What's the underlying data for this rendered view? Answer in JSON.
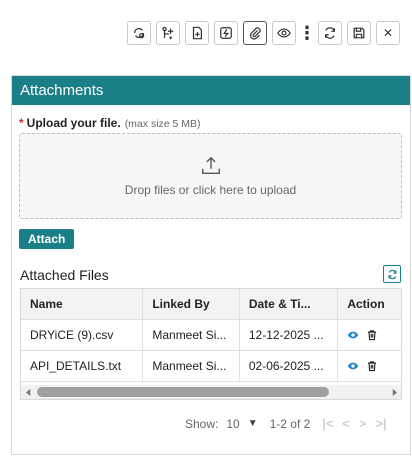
{
  "toolbar": {
    "buttons": [
      {
        "icon": "settings-sync-icon"
      },
      {
        "icon": "add-flow-icon"
      },
      {
        "icon": "add-document-icon"
      },
      {
        "icon": "activity-icon"
      },
      {
        "icon": "paperclip-icon"
      },
      {
        "icon": "eye-icon"
      },
      {
        "icon": "more-vertical-icon"
      },
      {
        "icon": "refresh-icon"
      },
      {
        "icon": "save-icon"
      },
      {
        "icon": "close-icon"
      }
    ],
    "more_glyph": "⋮",
    "close_glyph": "✕"
  },
  "panel": {
    "title": "Attachments",
    "accent_color": "#1a7f86"
  },
  "upload": {
    "required_mark": "*",
    "label": "Upload your file.",
    "hint": "(max size 5 MB)",
    "dropzone_text": "Drop files or click here to upload",
    "attach_label": "Attach"
  },
  "files": {
    "title": "Attached Files",
    "columns": [
      "Name",
      "Linked By",
      "Date & Ti...",
      "Action"
    ],
    "rows": [
      {
        "name": "DRYiCE (9).csv",
        "linked_by": "Manmeet Si...",
        "date": "12-12-2025 ..."
      },
      {
        "name": "API_DETAILS.txt",
        "linked_by": "Manmeet Si...",
        "date": "02-06-2025 ..."
      }
    ],
    "scroll_fraction": 0.83
  },
  "pager": {
    "show_label": "Show:",
    "page_size": "10",
    "range": "1-2 of 2",
    "first": "|<",
    "prev": "<",
    "next": ">",
    "last": ">|"
  }
}
